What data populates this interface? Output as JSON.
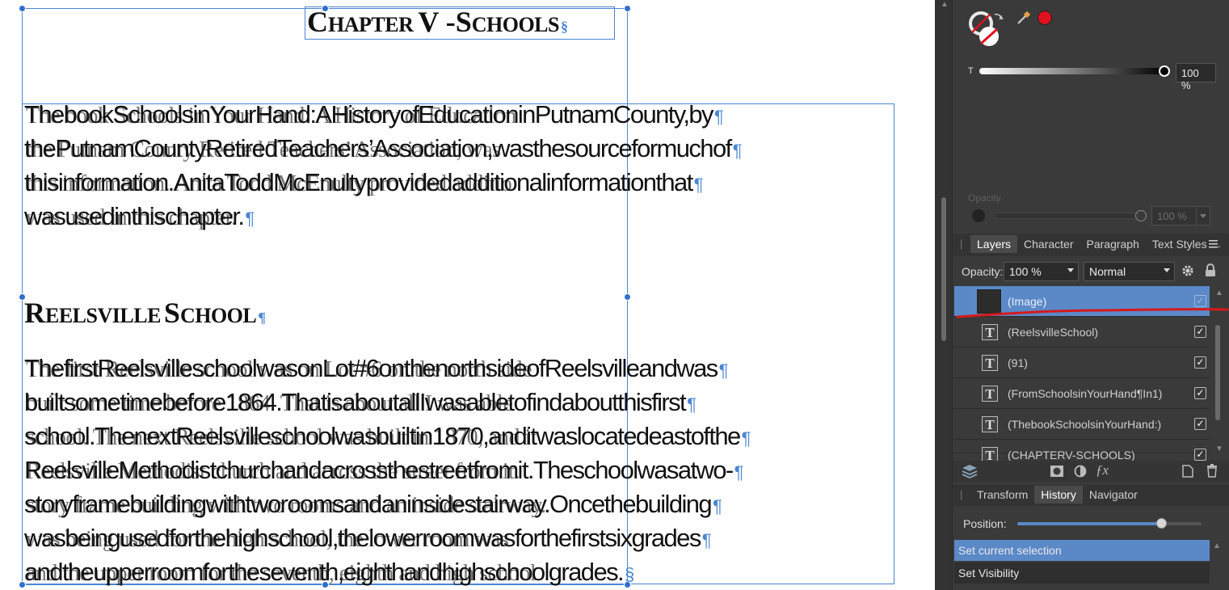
{
  "document": {
    "chapter_title": {
      "big1": "C",
      "small1": "HAPTER",
      "big2": "V",
      "sep": " -",
      "big3": "S",
      "small2": "CHOOLS"
    },
    "intro_lines": [
      {
        "text": "ThebookSchoolsinYourHand:AHistoryofEducationinPutnamCounty,by",
        "ghost": "The book Schools in Your Hand: A History of Education"
      },
      {
        "text": "thePutnamCountyRetiredTeachers’Association,wasthesourceformuchof",
        "ghost": "the Putnam County Retired Teachers’ Association, was"
      },
      {
        "text": "thisinformation.AnitaToddMcEnultyprovidedadditionalinformationthat",
        "ghost": "this information. Anita Todd McEnulty provided additio"
      },
      {
        "text": "wasusedinthischapter.",
        "ghost": "was used in this chapter."
      }
    ],
    "section_heading": {
      "big1": "R",
      "small1": "EELSVILLE",
      "big2": "S",
      "small2": "CHOOL"
    },
    "body_lines": [
      {
        "text": "ThefirstReelsvilleschoolwasonLot#6onthenorthsideofReelsvilleandwas",
        "ghost": "The first Reelsville school was on Lot #6 on the north side"
      },
      {
        "text": "builtsometimebefore1864.ThatisaboutallIwasabletofindaboutthisfirst",
        "ghost": "built some time before 1864. That is about all I was able"
      },
      {
        "text": "school.ThenextReelsvilleschoolwasbuiltin1870,anditwaslocatedeastofthe",
        "ghost": "school. The next Reelsville school was built in 1870, and it"
      },
      {
        "text": "ReelsvilleMethodistchurchandacrossthestreetfromit.Theschoolwasatwo-",
        "ghost": "Reelsville Methodist church and across the street from it."
      },
      {
        "text": "storyframebuildingwithtworoomsandaninsidestairway.Oncethebuilding",
        "ghost": "story frame building with two rooms and an inside stairway."
      },
      {
        "text": "wasbeingusedforthehighschool,thelowerroomwasforthefirstsixgrades",
        "ghost": "was being used for the high school, the lower room was"
      },
      {
        "text": "andtheupperroomfortheseventh,eighthandhighschoolgrades.",
        "ghost": "and the upper room for the seventh, eighth and high school"
      }
    ],
    "pilcrow": "¶",
    "section_mark": "§"
  },
  "panel": {
    "color": {
      "accent_color": "#e0101e",
      "stroke_label": "T",
      "stroke_value": "100 %",
      "opacity_label": "Opacity",
      "opacity_value": "100 %"
    },
    "layers_tabs": [
      "Layers",
      "Character",
      "Paragraph",
      "Text Styles"
    ],
    "layers_toolbar": {
      "opacity_label": "Opacity:",
      "opacity_value": "100 %",
      "blend_mode": "Normal"
    },
    "layers": [
      {
        "name": "(Image)",
        "kind": "image",
        "selected": true,
        "visible": true
      },
      {
        "name": "(ReelsvilleSchool)",
        "kind": "text",
        "selected": false,
        "visible": true
      },
      {
        "name": "(91)",
        "kind": "text",
        "selected": false,
        "visible": true
      },
      {
        "name": "(FromSchoolsinYourHand¶In1)",
        "kind": "text",
        "selected": false,
        "visible": true
      },
      {
        "name": "(ThebookSchoolsinYourHand:)",
        "kind": "text",
        "selected": false,
        "visible": true
      },
      {
        "name": "(CHAPTERV-SCHOOLS)",
        "kind": "text",
        "selected": false,
        "visible": true
      }
    ],
    "bottom_tabs": [
      "Transform",
      "History",
      "Navigator"
    ],
    "history": {
      "position_label": "Position:",
      "position_value": 0.78,
      "items": [
        {
          "label": "Set current selection",
          "selected": true
        },
        {
          "label": "Set Visibility",
          "selected": false
        }
      ]
    }
  }
}
